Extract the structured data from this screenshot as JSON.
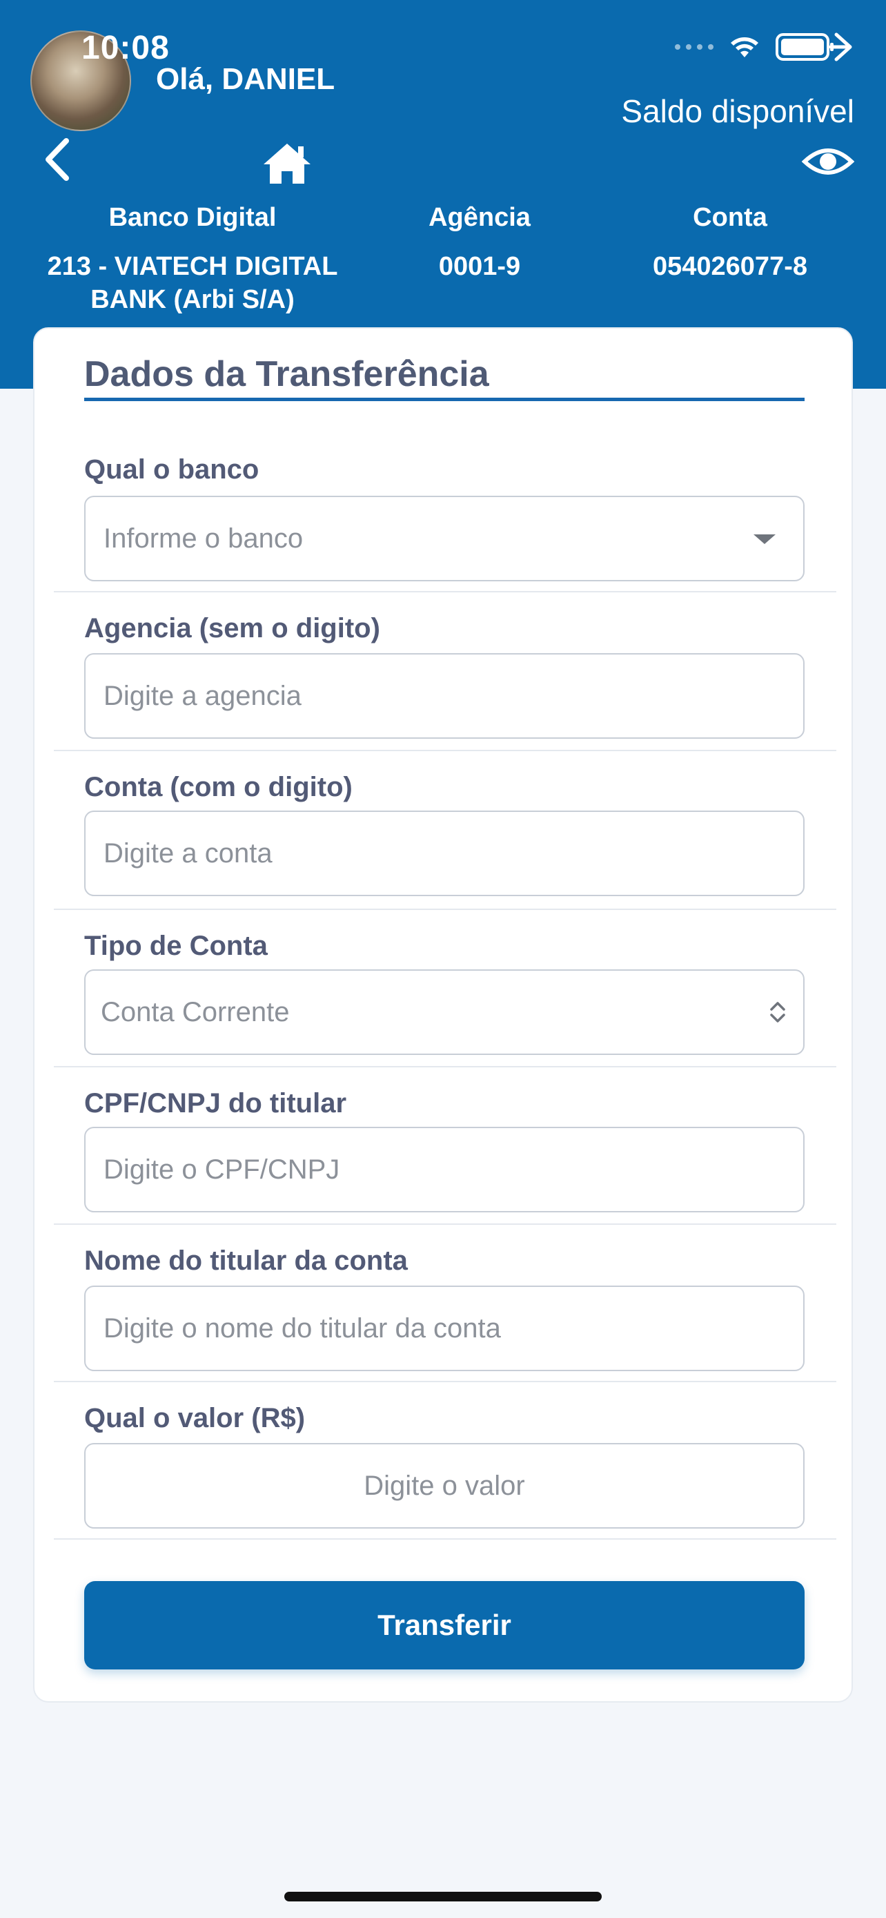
{
  "status_bar": {
    "time": "10:08"
  },
  "header": {
    "greeting": "Olá, DANIEL",
    "balance_label": "Saldo disponível",
    "columns": [
      {
        "label": "Banco Digital",
        "value": "213 - VIATECH DIGITAL BANK (Arbi S/A)"
      },
      {
        "label": "Agência",
        "value": "0001-9"
      },
      {
        "label": "Conta",
        "value": "054026077-8"
      }
    ]
  },
  "form": {
    "title": "Dados da Transferência",
    "fields": [
      {
        "label": "Qual o banco",
        "placeholder": "Informe o banco",
        "kind": "dropdown"
      },
      {
        "label": "Agencia (sem o digito)",
        "placeholder": "Digite a agencia",
        "kind": "text"
      },
      {
        "label": "Conta (com o digito)",
        "placeholder": "Digite a conta",
        "kind": "text"
      },
      {
        "label": "Tipo de Conta",
        "value": "Conta Corrente",
        "kind": "select"
      },
      {
        "label": "CPF/CNPJ do titular",
        "placeholder": "Digite o CPF/CNPJ",
        "kind": "text"
      },
      {
        "label": "Nome do titular da conta",
        "placeholder": "Digite o nome do titular da conta",
        "kind": "text"
      },
      {
        "label": "Qual o valor (R$)",
        "placeholder": "Digite o valor",
        "kind": "text"
      }
    ],
    "submit_label": "Transferir"
  },
  "icons": {
    "back": "chevron-left-icon",
    "home": "home-icon",
    "eye": "eye-icon",
    "wifi": "wifi-icon",
    "battery": "battery-icon"
  },
  "colors": {
    "primary": "#0a6aae",
    "label": "#525a76",
    "placeholder": "#8c9199"
  }
}
